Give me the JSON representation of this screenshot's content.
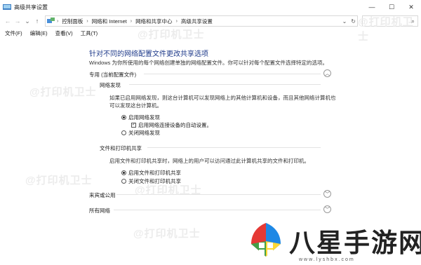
{
  "window": {
    "title": "高级共享设置",
    "controls": {
      "minimize": "—",
      "maximize": "☐",
      "close": "✕"
    }
  },
  "nav": {
    "back": "←",
    "forward": "→",
    "recent": "⌄",
    "up": "↑"
  },
  "address": {
    "crumbs": [
      "控制面板",
      "网络和 Internet",
      "网络和共享中心",
      "高级共享设置"
    ],
    "separator": "›",
    "dropdown": "⌄",
    "refresh": "↻"
  },
  "search": {
    "icon": "⌕"
  },
  "menu": [
    "文件(F)",
    "编辑(E)",
    "查看(V)",
    "工具(T)"
  ],
  "main": {
    "title": "针对不同的网络配置文件更改共享选项",
    "description": "Windows 为你所使用的每个网络创建单独的网络配置文件。你可以针对每个配置文件选择特定的选项。",
    "private_section": {
      "label": "专用 (当前配置文件)",
      "chevron": "︿",
      "discovery": {
        "label": "网络发现",
        "text_line1": "如果已启用网络发现，则这台计算机可以发现网络上的其他计算机和设备，而且其他网络计算机也",
        "text_line2": "可以发现这台计算机。",
        "opt_on": "启用网络发现",
        "opt_auto": "启用网络连接设备的自动设置。",
        "opt_off": "关闭网络发现",
        "check_mark": "✓"
      },
      "file_sharing": {
        "label": "文件和打印机共享",
        "text": "启用文件和打印机共享时，网络上的用户可以访问通过此计算机共享的文件和打印机。",
        "opt_on": "启用文件和打印机共享",
        "opt_off": "关闭文件和打印机共享"
      }
    },
    "guest_section": {
      "label": "来宾或公用",
      "chevron": "﹀"
    },
    "all_section": {
      "label": "所有网络",
      "chevron": "﹀"
    }
  },
  "watermark": {
    "text": "@打印机卫士",
    "brand": "八星手游网",
    "url": "www.lyshbx.com"
  },
  "colors": {
    "title_blue": "#1e3a8a",
    "logo_red": "#e53935",
    "logo_green": "#43a047",
    "logo_yellow": "#fdd835",
    "logo_blue": "#1e88e5"
  }
}
